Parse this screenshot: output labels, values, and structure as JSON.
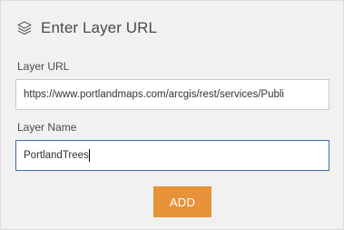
{
  "header": {
    "icon": "layers-icon",
    "title": "Enter Layer URL"
  },
  "layer_url": {
    "label": "Layer URL",
    "value": "https://www.portlandmaps.com/arcgis/rest/services/Publi"
  },
  "layer_name": {
    "label": "Layer Name",
    "value": "PortlandTrees"
  },
  "add_button": {
    "label": "ADD"
  },
  "colors": {
    "panel_background": "#f1f1f1",
    "focused_border": "#3a6fb0",
    "button_accent": "#e8923a"
  }
}
